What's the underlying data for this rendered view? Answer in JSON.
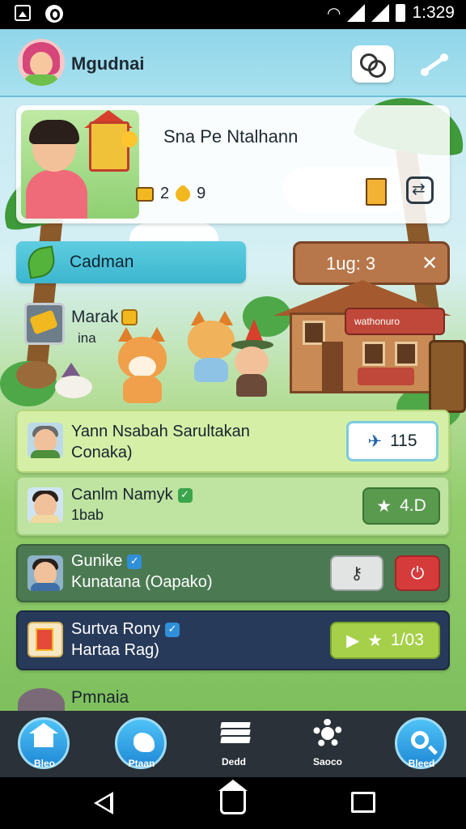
{
  "status_bar": {
    "time": "1:329"
  },
  "app": {
    "title": "Mgudnai"
  },
  "quest": {
    "title": "Sna Pe Ntalhann",
    "stat_value": "2",
    "heart_value": "9"
  },
  "location": {
    "label": "Cadman"
  },
  "sign": {
    "label": "1ug: 3",
    "close": "✕"
  },
  "house_banner": "wathonuro",
  "inventory": {
    "title": "Marak",
    "subtitle": "ina"
  },
  "rows": [
    {
      "name": "Yann Nsabah Sarultakan",
      "sub": "Conaka)",
      "button": "115",
      "button_icon": "pin-icon"
    },
    {
      "name": "Canlm Namyk",
      "sub": "1bab",
      "button": "4.D",
      "button_icon": "star-icon",
      "verify": "✓"
    },
    {
      "name": "Gunike",
      "sub": "Kunatana (Oapako)",
      "verify": "✓"
    },
    {
      "name": "Surtva Rony",
      "sub": "Hartaa Rag)",
      "button": "1/03",
      "verify": "✓"
    }
  ],
  "partial_row": {
    "label": "Pmnaia"
  },
  "bottom_nav": [
    {
      "label": "Bleo",
      "icon": "home-icon"
    },
    {
      "label": "Ptaan",
      "icon": "bird-icon"
    },
    {
      "label": "Dedd",
      "icon": "layers-icon"
    },
    {
      "label": "Saoco",
      "icon": "gear-icon"
    },
    {
      "label": "Bleed",
      "icon": "search-icon"
    }
  ],
  "colors": {
    "appbar": "#8fd6ea",
    "row1": "#d6efa6",
    "row2": "#bfe3a0",
    "row3": "#4b7a52",
    "row4": "#283a5a",
    "nav": "#2a3138",
    "accent_blue": "#1f88d6",
    "accent_green": "#5a9a4e",
    "accent_red": "#d63b3b",
    "accent_lime": "#a6d04a"
  }
}
